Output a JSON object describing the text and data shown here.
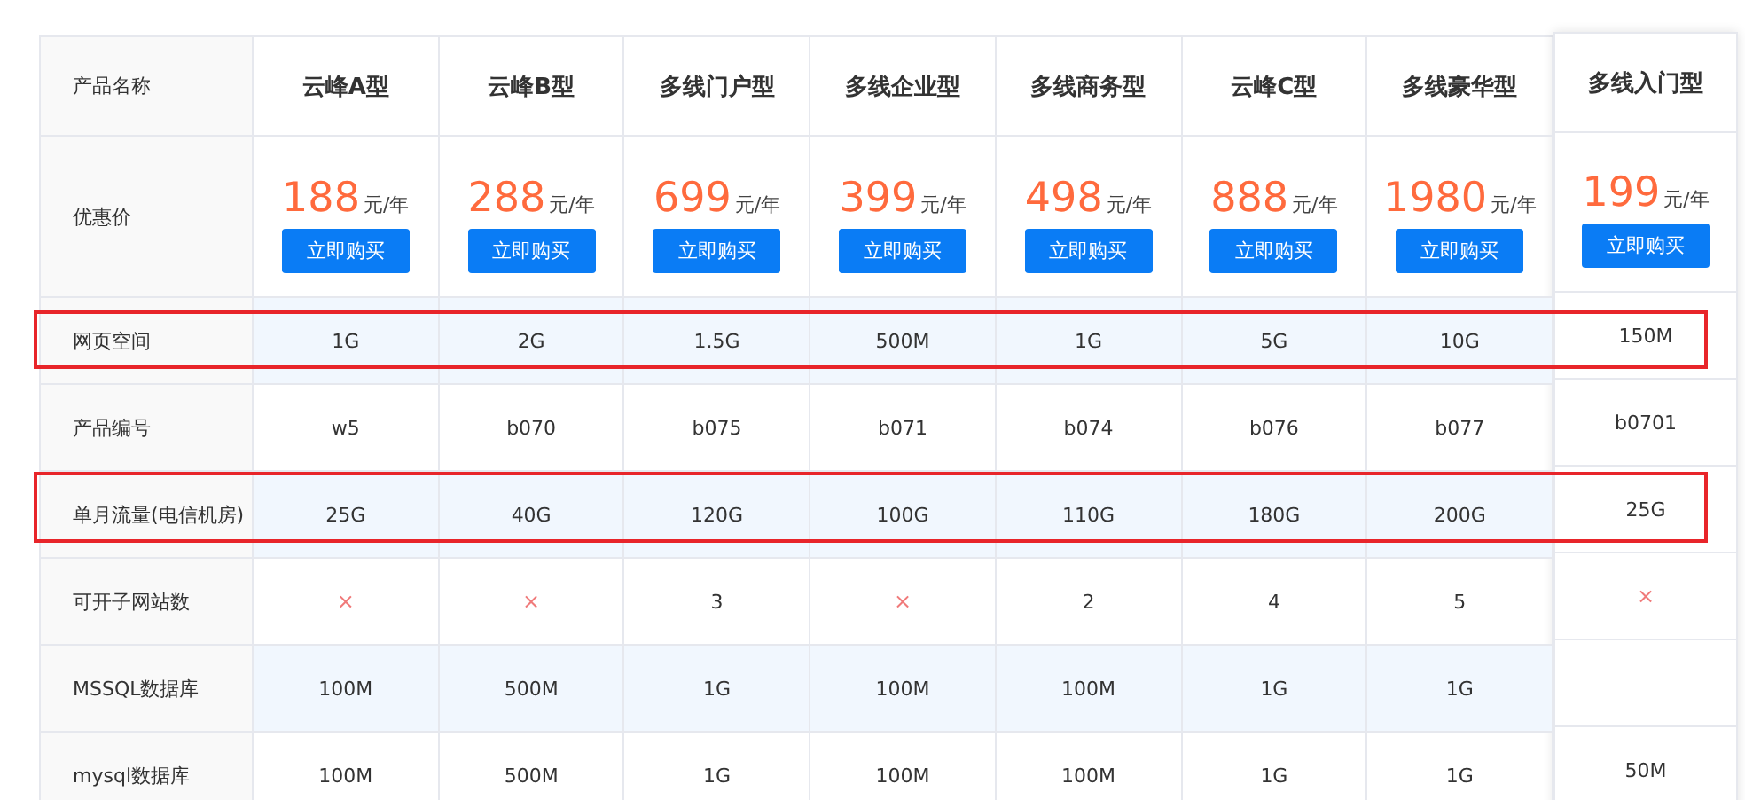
{
  "corner_label": "产品名称",
  "price_label": "优惠价",
  "products": [
    {
      "name": "云峰A型",
      "price": "188",
      "unit": "元/年",
      "button": "立即购买",
      "featured": false
    },
    {
      "name": "云峰B型",
      "price": "288",
      "unit": "元/年",
      "button": "立即购买",
      "featured": false
    },
    {
      "name": "多线门户型",
      "price": "699",
      "unit": "元/年",
      "button": "立即购买",
      "featured": false
    },
    {
      "name": "多线企业型",
      "price": "399",
      "unit": "元/年",
      "button": "立即购买",
      "featured": false
    },
    {
      "name": "多线商务型",
      "price": "498",
      "unit": "元/年",
      "button": "立即购买",
      "featured": false
    },
    {
      "name": "云峰C型",
      "price": "888",
      "unit": "元/年",
      "button": "立即购买",
      "featured": false
    },
    {
      "name": "多线豪华型",
      "price": "1980",
      "unit": "元/年",
      "button": "立即购买",
      "featured": false
    },
    {
      "name": "多线入门型",
      "price": "199",
      "unit": "元/年",
      "button": "立即购买",
      "featured": true
    }
  ],
  "spec_rows": [
    {
      "label": "网页空间",
      "shaded": true,
      "highlighted": true,
      "cells": [
        {
          "kind": "text",
          "text": "1G"
        },
        {
          "kind": "text",
          "text": "2G"
        },
        {
          "kind": "text",
          "text": "1.5G"
        },
        {
          "kind": "text",
          "text": "500M"
        },
        {
          "kind": "text",
          "text": "1G"
        },
        {
          "kind": "text",
          "text": "5G"
        },
        {
          "kind": "text",
          "text": "10G"
        },
        {
          "kind": "text",
          "text": "150M"
        }
      ]
    },
    {
      "label": "产品编号",
      "shaded": false,
      "highlighted": false,
      "cells": [
        {
          "kind": "text",
          "text": "w5"
        },
        {
          "kind": "text",
          "text": "b070"
        },
        {
          "kind": "text",
          "text": "b075"
        },
        {
          "kind": "text",
          "text": "b071"
        },
        {
          "kind": "text",
          "text": "b074"
        },
        {
          "kind": "text",
          "text": "b076"
        },
        {
          "kind": "text",
          "text": "b077"
        },
        {
          "kind": "text",
          "text": "b0701"
        }
      ]
    },
    {
      "label": "单月流量(电信机房)",
      "shaded": true,
      "highlighted": true,
      "cells": [
        {
          "kind": "text",
          "text": "25G"
        },
        {
          "kind": "text",
          "text": "40G"
        },
        {
          "kind": "text",
          "text": "120G"
        },
        {
          "kind": "text",
          "text": "100G"
        },
        {
          "kind": "text",
          "text": "110G"
        },
        {
          "kind": "text",
          "text": "180G"
        },
        {
          "kind": "text",
          "text": "200G"
        },
        {
          "kind": "text",
          "text": "25G"
        }
      ]
    },
    {
      "label": "可开子网站数",
      "shaded": false,
      "highlighted": false,
      "cells": [
        {
          "kind": "cross",
          "text": "×"
        },
        {
          "kind": "cross",
          "text": "×"
        },
        {
          "kind": "text",
          "text": "3"
        },
        {
          "kind": "cross",
          "text": "×"
        },
        {
          "kind": "text",
          "text": "2"
        },
        {
          "kind": "text",
          "text": "4"
        },
        {
          "kind": "text",
          "text": "5"
        },
        {
          "kind": "cross",
          "text": "×"
        }
      ]
    },
    {
      "label": "MSSQL数据库",
      "shaded": true,
      "highlighted": false,
      "cells": [
        {
          "kind": "text",
          "text": "100M"
        },
        {
          "kind": "text",
          "text": "500M"
        },
        {
          "kind": "text",
          "text": "1G"
        },
        {
          "kind": "text",
          "text": "100M"
        },
        {
          "kind": "text",
          "text": "100M"
        },
        {
          "kind": "text",
          "text": "1G"
        },
        {
          "kind": "text",
          "text": "1G"
        },
        {
          "kind": "blank"
        }
      ]
    },
    {
      "label": "mysql数据库",
      "shaded": false,
      "highlighted": false,
      "cells": [
        {
          "kind": "text",
          "text": "100M"
        },
        {
          "kind": "text",
          "text": "500M"
        },
        {
          "kind": "text",
          "text": "1G"
        },
        {
          "kind": "text",
          "text": "100M"
        },
        {
          "kind": "text",
          "text": "100M"
        },
        {
          "kind": "text",
          "text": "1G"
        },
        {
          "kind": "text",
          "text": "1G"
        },
        {
          "kind": "text",
          "text": "50M"
        }
      ]
    }
  ]
}
